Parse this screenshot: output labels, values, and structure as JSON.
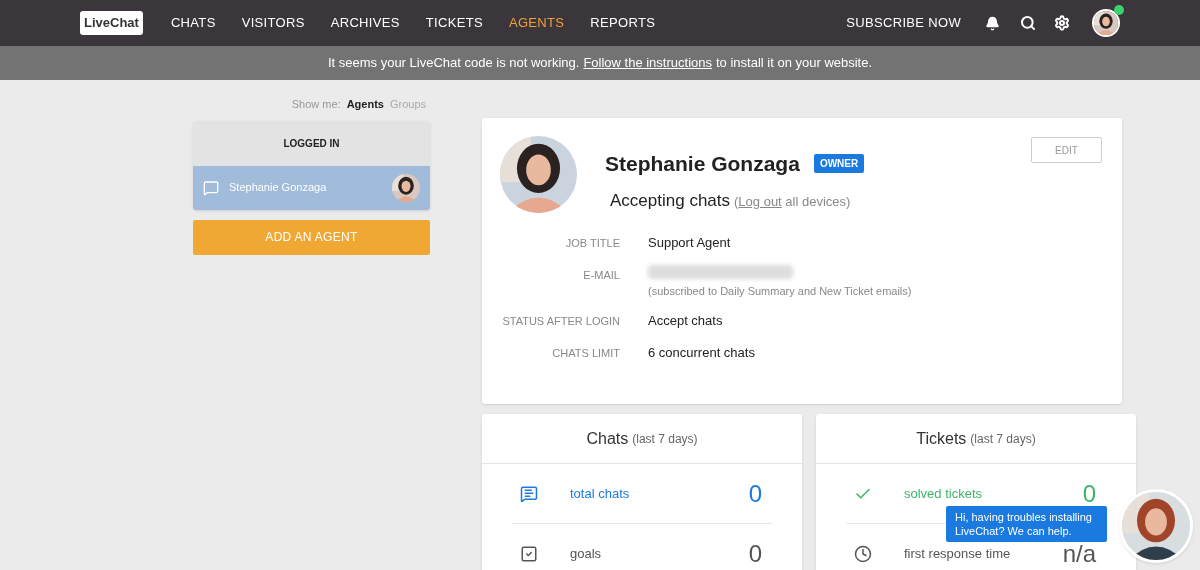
{
  "header": {
    "logo": "LiveChat",
    "nav": [
      {
        "label": "CHATS",
        "selected": false
      },
      {
        "label": "VISITORS",
        "selected": false
      },
      {
        "label": "ARCHIVES",
        "selected": false
      },
      {
        "label": "TICKETS",
        "selected": false
      },
      {
        "label": "AGENTS",
        "selected": true
      },
      {
        "label": "REPORTS",
        "selected": false
      }
    ],
    "subscribe": "SUBSCRIBE NOW",
    "online": true
  },
  "banner": {
    "before": "It seems your LiveChat code is not working.",
    "link": "Follow the instructions",
    "after": "to install it on your website."
  },
  "sidebar": {
    "show_me": "Show me:",
    "filters": [
      {
        "label": "Agents",
        "selected": true
      },
      {
        "label": "Groups",
        "selected": false
      }
    ],
    "section": "LOGGED IN",
    "agents": [
      {
        "name": "Stephanie Gonzaga",
        "selected": true
      }
    ],
    "add_button": "ADD AN AGENT"
  },
  "profile": {
    "name": "Stephanie Gonzaga",
    "badge": "OWNER",
    "edit": "EDIT",
    "status": "Accepting chats",
    "logout_open": "(",
    "logout_link": "Log out",
    "logout_rest": "all devices)",
    "fields": [
      {
        "label": "JOB TITLE",
        "value": "Support Agent"
      },
      {
        "label": "E-MAIL",
        "redacted": true,
        "note": "(subscribed to Daily Summary and New Ticket emails)"
      },
      {
        "label": "STATUS AFTER LOGIN",
        "value": "Accept chats"
      },
      {
        "label": "CHATS LIMIT",
        "value": "6 concurrent chats"
      }
    ]
  },
  "stats": [
    {
      "title": "Chats",
      "period": "(last 7 days)",
      "rows": [
        {
          "kind": "chat",
          "label": "total chats",
          "value": "0",
          "color": "#1a7ae0"
        },
        {
          "kind": "goal",
          "label": "goals",
          "value": "0",
          "color": "#555555"
        }
      ]
    },
    {
      "title": "Tickets",
      "period": "(last 7 days)",
      "rows": [
        {
          "kind": "check",
          "label": "solved tickets",
          "value": "0",
          "color": "#3bb56a"
        },
        {
          "kind": "clock",
          "label": "first response time",
          "value": "n/a",
          "color": "#555555"
        }
      ]
    }
  ],
  "chat_bubble": {
    "text": "Hi, having troubles installing LiveChat? We can help."
  }
}
